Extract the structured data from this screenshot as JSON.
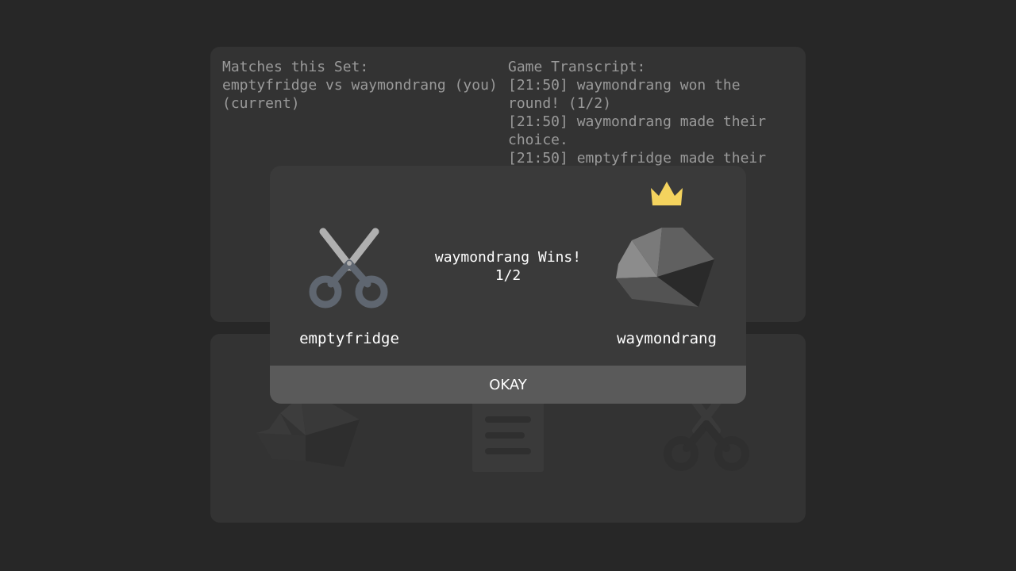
{
  "set_panel": {
    "matches_heading": "Matches this Set:",
    "matches": [
      {
        "label": "emptyfridge vs waymondrang (you)",
        "status": "(current)"
      }
    ]
  },
  "transcript": {
    "heading": "Game Transcript:",
    "lines": [
      "[21:50] waymondrang won the",
      "round! (1/2)",
      "[21:50] waymondrang made their",
      "choice.",
      "[21:50] emptyfridge made their"
    ]
  },
  "choices_panel": {
    "options": [
      "rock-icon",
      "paper-icon",
      "scissors-icon"
    ]
  },
  "dialog": {
    "left_player": {
      "name": "emptyfridge",
      "choice": "scissors-icon"
    },
    "right_player": {
      "name": "waymondrang",
      "choice": "rock-icon",
      "winner_icon": "crown-icon"
    },
    "result_line": "waymondrang Wins!",
    "score": "1/2",
    "okay_label": "OKAY"
  },
  "colors": {
    "background": "#272727",
    "panel": "#333333",
    "dialog": "#3a3a3a",
    "button": "#5a5a5a",
    "crown": "#f4d35e",
    "scissors_handle": "#5f6670",
    "scissors_blade": "#b0b0b0"
  }
}
